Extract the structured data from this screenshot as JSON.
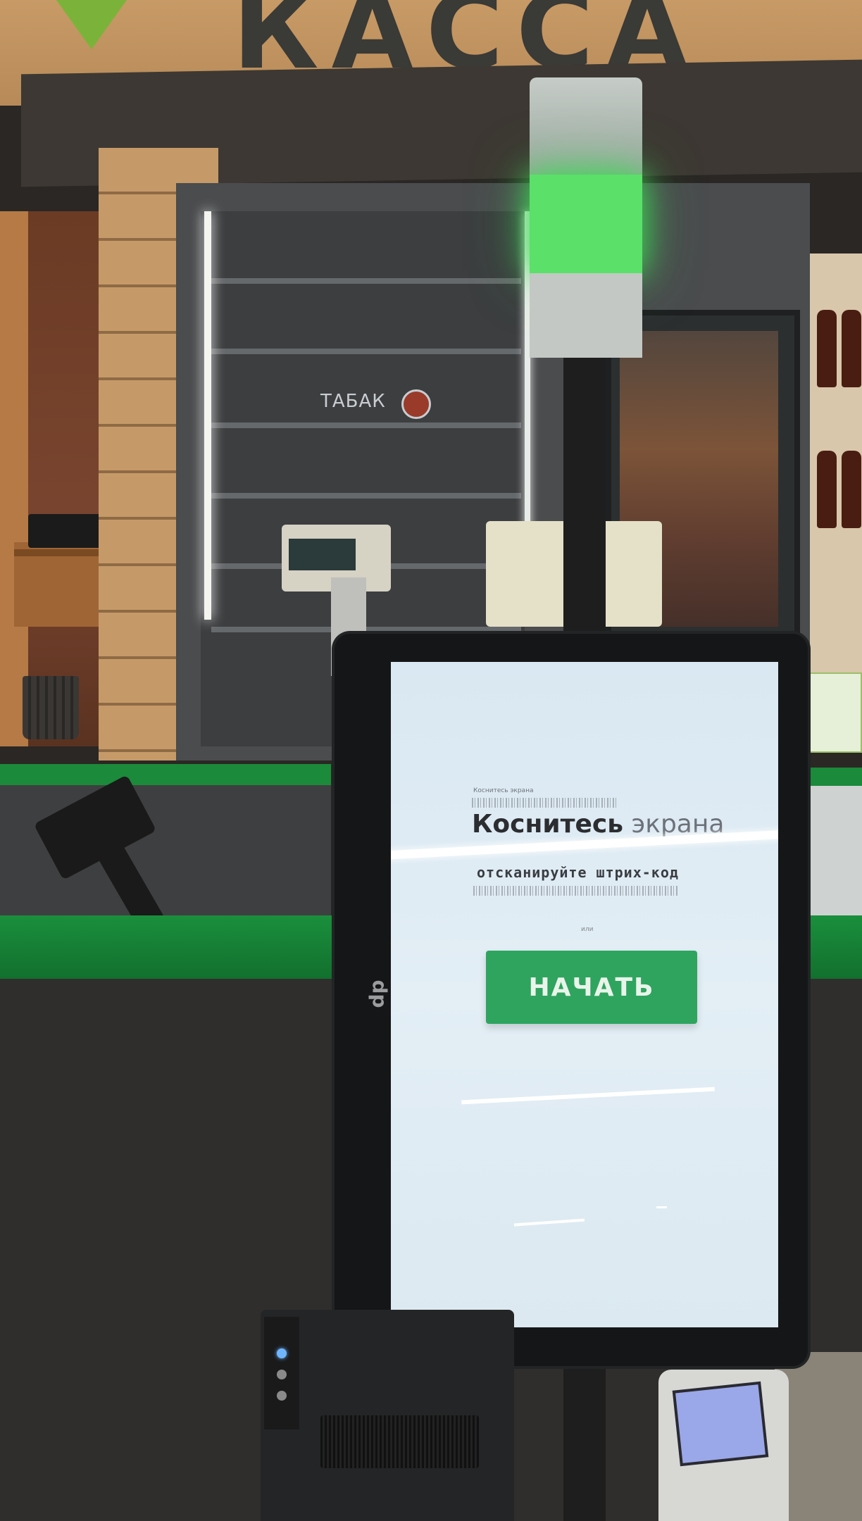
{
  "store": {
    "sign_text": "КАССА",
    "shelf_label": "ТАБАК"
  },
  "kiosk": {
    "brand": "dp",
    "screen": {
      "caption_small": "Коснитесь экрана",
      "title_bold": "Коснитесь",
      "title_light": "экрана",
      "subtitle": "отсканируйте штрих-код",
      "note": "или",
      "start_button_label": "НАЧАТЬ"
    }
  },
  "colors": {
    "start_button": "#2fa45f",
    "status_light": "#5be06a",
    "counter_green": "#1a8f3c"
  }
}
